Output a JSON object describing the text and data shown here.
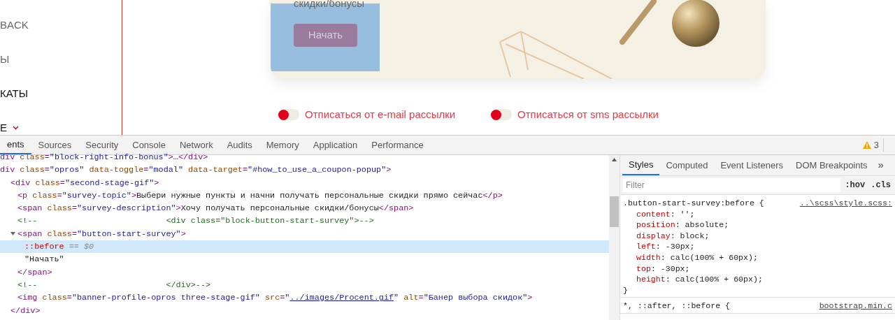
{
  "sidebar": {
    "items": [
      {
        "label": "BACK",
        "active": false,
        "dropdown": false
      },
      {
        "label": "Ы",
        "active": false,
        "dropdown": false
      },
      {
        "label": "КАТЫ",
        "active": true,
        "dropdown": false
      },
      {
        "label": "E",
        "active": true,
        "dropdown": true
      }
    ]
  },
  "banner": {
    "description": "скидки/бонусы",
    "button": "Начать"
  },
  "toggles": [
    {
      "label": "Отписаться от e-mail рассылки",
      "on": false
    },
    {
      "label": "Отписаться от sms рассылки",
      "on": false
    }
  ],
  "devtools": {
    "tabs": [
      {
        "label": "ents",
        "selected": true
      },
      {
        "label": "Sources",
        "selected": false
      },
      {
        "label": "Security",
        "selected": false
      },
      {
        "label": "Console",
        "selected": false
      },
      {
        "label": "Network",
        "selected": false
      },
      {
        "label": "Audits",
        "selected": false
      },
      {
        "label": "Memory",
        "selected": false
      },
      {
        "label": "Application",
        "selected": false
      },
      {
        "label": "Performance",
        "selected": false
      }
    ],
    "warnings": "3",
    "elements": [
      {
        "tokens": [
          {
            "kind": "tag",
            "text": "div"
          },
          {
            "kind": "attr",
            "text": " class"
          },
          {
            "kind": "tag",
            "text": "="
          },
          {
            "kind": "val",
            "text": "\"block-right-info-bonus\""
          },
          {
            "kind": "tag",
            "text": ">"
          },
          {
            "kind": "text",
            "text": "…"
          },
          {
            "kind": "tag",
            "text": "</div>"
          }
        ]
      },
      {
        "tokens": [
          {
            "kind": "tag",
            "text": "div"
          },
          {
            "kind": "attr",
            "text": " class"
          },
          {
            "kind": "tag",
            "text": "="
          },
          {
            "kind": "val",
            "text": "\"opros\""
          },
          {
            "kind": "attr",
            "text": " data-toggle"
          },
          {
            "kind": "tag",
            "text": "="
          },
          {
            "kind": "val",
            "text": "\"modal\""
          },
          {
            "kind": "attr",
            "text": " data-target"
          },
          {
            "kind": "tag",
            "text": "="
          },
          {
            "kind": "val",
            "text": "\"#how_to_use_a_coupon-popup\""
          },
          {
            "kind": "tag",
            "text": ">"
          }
        ],
        "children": [
          {
            "tokens": [
              {
                "kind": "tag",
                "text": "<div"
              },
              {
                "kind": "attr",
                "text": " class"
              },
              {
                "kind": "tag",
                "text": "="
              },
              {
                "kind": "val",
                "text": "\"second-stage-gif\""
              },
              {
                "kind": "tag",
                "text": ">"
              }
            ],
            "children": [
              {
                "tokens": [
                  {
                    "kind": "tag",
                    "text": "<p"
                  },
                  {
                    "kind": "attr",
                    "text": " class"
                  },
                  {
                    "kind": "tag",
                    "text": "="
                  },
                  {
                    "kind": "val",
                    "text": "\"survey-topic\""
                  },
                  {
                    "kind": "tag",
                    "text": ">"
                  },
                  {
                    "kind": "text",
                    "text": "Выбери нужные пункты и начни получать персональные скидки прямо сейчас"
                  },
                  {
                    "kind": "tag",
                    "text": "</p>"
                  }
                ]
              },
              {
                "tokens": [
                  {
                    "kind": "tag",
                    "text": "<span"
                  },
                  {
                    "kind": "attr",
                    "text": " class"
                  },
                  {
                    "kind": "tag",
                    "text": "="
                  },
                  {
                    "kind": "val",
                    "text": "\"survey-description\""
                  },
                  {
                    "kind": "tag",
                    "text": ">"
                  },
                  {
                    "kind": "text",
                    "text": "Хочу получать персональные скидки/бонусы"
                  },
                  {
                    "kind": "tag",
                    "text": "</span>"
                  }
                ]
              },
              {
                "tokens": [
                  {
                    "kind": "comment",
                    "text": "<!--                          <div class=\"block-button-start-survey\">-->"
                  }
                ]
              },
              {
                "tokens": [
                  {
                    "kind": "tag",
                    "text": "<span"
                  },
                  {
                    "kind": "attr",
                    "text": " class"
                  },
                  {
                    "kind": "tag",
                    "text": "="
                  },
                  {
                    "kind": "val",
                    "text": "\"button-start-survey\""
                  },
                  {
                    "kind": "tag",
                    "text": ">"
                  }
                ],
                "expanded": true,
                "children": [
                  {
                    "tokens": [
                      {
                        "kind": "pseudo",
                        "text": "::before"
                      },
                      {
                        "kind": "dim",
                        "text": " == $0"
                      }
                    ],
                    "selected": true
                  },
                  {
                    "tokens": [
                      {
                        "kind": "text",
                        "text": "\"Начать\""
                      }
                    ],
                    "selected": false
                  }
                ],
                "close": [
                  {
                    "kind": "tag",
                    "text": "</span>"
                  }
                ]
              },
              {
                "tokens": [
                  {
                    "kind": "comment",
                    "text": "<!--                          </div>-->"
                  }
                ]
              },
              {
                "tokens": [
                  {
                    "kind": "tag",
                    "text": "<img"
                  },
                  {
                    "kind": "attr",
                    "text": " class"
                  },
                  {
                    "kind": "tag",
                    "text": "="
                  },
                  {
                    "kind": "val",
                    "text": "\"banner-profile-opros three-stage-gif\""
                  },
                  {
                    "kind": "attr",
                    "text": " src"
                  },
                  {
                    "kind": "tag",
                    "text": "="
                  },
                  {
                    "kind": "val",
                    "text": "\""
                  },
                  {
                    "kind": "link",
                    "text": "../images/Procent.gif"
                  },
                  {
                    "kind": "val",
                    "text": "\""
                  },
                  {
                    "kind": "attr",
                    "text": " alt"
                  },
                  {
                    "kind": "tag",
                    "text": "="
                  },
                  {
                    "kind": "val",
                    "text": "\"Банер выбора скидок\""
                  },
                  {
                    "kind": "tag",
                    "text": ">"
                  }
                ]
              }
            ],
            "close": [
              {
                "kind": "tag",
                "text": "</div>"
              }
            ]
          }
        ]
      }
    ],
    "styles": {
      "tabs": [
        {
          "label": "Styles",
          "selected": true
        },
        {
          "label": "Computed",
          "selected": false
        },
        {
          "label": "Event Listeners",
          "selected": false
        },
        {
          "label": "DOM Breakpoints",
          "selected": false
        }
      ],
      "more": "»",
      "filter": {
        "placeholder": "Filter"
      },
      "buttons": [
        ":hov",
        ".cls"
      ],
      "rules": [
        {
          "selector": ".button-start-survey:before {",
          "source": "..\\scss\\style.scss:",
          "declarations": [
            {
              "property": "content",
              "value": ": '';"
            },
            {
              "property": "position",
              "value": ": absolute;"
            },
            {
              "property": "display",
              "value": ": block;"
            },
            {
              "property": "left",
              "value": ": -30px;"
            },
            {
              "property": "width",
              "value": ": calc(100% + 60px);"
            },
            {
              "property": "top",
              "value": ": -30px;"
            },
            {
              "property": "height",
              "value": ": calc(100% + 60px);"
            }
          ],
          "close": "}"
        },
        {
          "selector": "*, ::after, ::before {",
          "source": "bootstrap.min.c"
        }
      ]
    }
  }
}
